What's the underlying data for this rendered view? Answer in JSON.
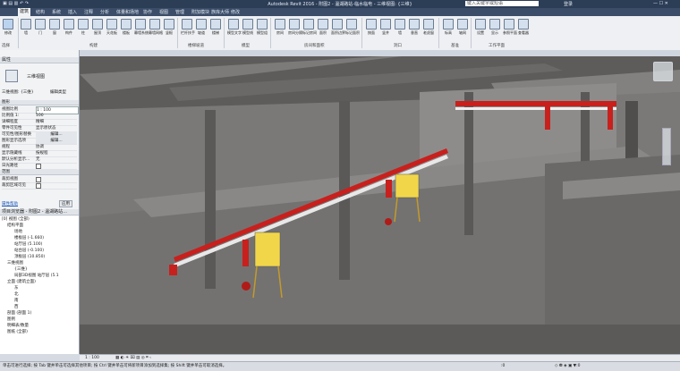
{
  "title": "Autodesk Revit 2016 -    附图2 - 温湖路站-临水临电 - 三维视图: {三维}",
  "title_right": {
    "search_placeholder": "键入关键字或短语",
    "user": "登录"
  },
  "tabs": [
    "建筑",
    "结构",
    "系统",
    "插入",
    "注释",
    "分析",
    "体量和场地",
    "协作",
    "视图",
    "管理",
    "附加模块",
    "族库大师",
    "修改"
  ],
  "ribbon": {
    "buttons": [
      "修改",
      "墙",
      "门",
      "窗",
      "构件",
      "柱",
      "屋顶",
      "天花板",
      "楼板",
      "幕墙系统",
      "幕墙网格",
      "竖梃",
      "栏杆扶手",
      "坡道",
      "楼梯",
      "模型文字",
      "模型线",
      "模型组",
      "房间",
      "房间分隔",
      "标记房间",
      "面积",
      "面积边界",
      "标记面积",
      "按面",
      "竖井",
      "墙",
      "垂直",
      "老虎窗",
      "标高",
      "轴网",
      "设置",
      "显示",
      "参照平面",
      "查看器"
    ],
    "panels": [
      "选择",
      "构建",
      "楼梯坡道",
      "模型",
      "房间和面积",
      "洞口",
      "基准",
      "工作平面"
    ]
  },
  "properties": {
    "header": "属性",
    "type_name": "三维视图",
    "selector": "三维视图: {三维}",
    "edit_type": "编辑类型",
    "section_graphics": "图形",
    "rows": [
      {
        "k": "视图比例",
        "v": "1 : 100"
      },
      {
        "k": "比例值 1:",
        "v": "100"
      },
      {
        "k": "详细程度",
        "v": "精细"
      },
      {
        "k": "零件可见性",
        "v": "显示原状态"
      },
      {
        "k": "可见性/图形替换",
        "v": "编辑..."
      },
      {
        "k": "图形显示选项",
        "v": "编辑..."
      },
      {
        "k": "规程",
        "v": "协调"
      },
      {
        "k": "显示隐藏线",
        "v": "按规程"
      },
      {
        "k": "默认分析显示...",
        "v": "无"
      },
      {
        "k": "日光路径",
        "v": ""
      }
    ],
    "section_extents": "范围",
    "extents_rows": [
      {
        "k": "裁剪视图",
        "v": ""
      },
      {
        "k": "裁剪区域可见",
        "v": ""
      }
    ],
    "help_link": "属性帮助",
    "apply": "应用"
  },
  "browser": {
    "header": "项目浏览器 - 附图2 - 温湖路站...",
    "items": [
      "[0] 视图 (全部)",
      "结构平面",
      "场地",
      "楼板层 (-1.660)",
      "站厅层 (5.100)",
      "站台层 (-0.100)",
      "顶板层 (10.850)",
      "三维视图",
      "{三维}",
      "局部3D视图 站厅层 (5.1",
      "立面 (建筑立面)",
      "东",
      "北",
      "南",
      "西",
      "剖面 (剖面 1)",
      "图例",
      "明细表/数量",
      "图纸 (全部)"
    ]
  },
  "viewbar": {
    "scale": "1 : 100"
  },
  "status": {
    "text": "单击可进行选择; 按 Tab 键并单击可选择其他项目; 按 Ctrl 键并单击可将新项目添加到选择集; 按 Shift 键并单击可取消选择。",
    "coord": ":0"
  },
  "colors": {
    "titlebar": "#2c3d56",
    "barrier_red": "#c8201d",
    "box_yellow": "#f2d64a",
    "concrete": "#6f6d6b"
  }
}
